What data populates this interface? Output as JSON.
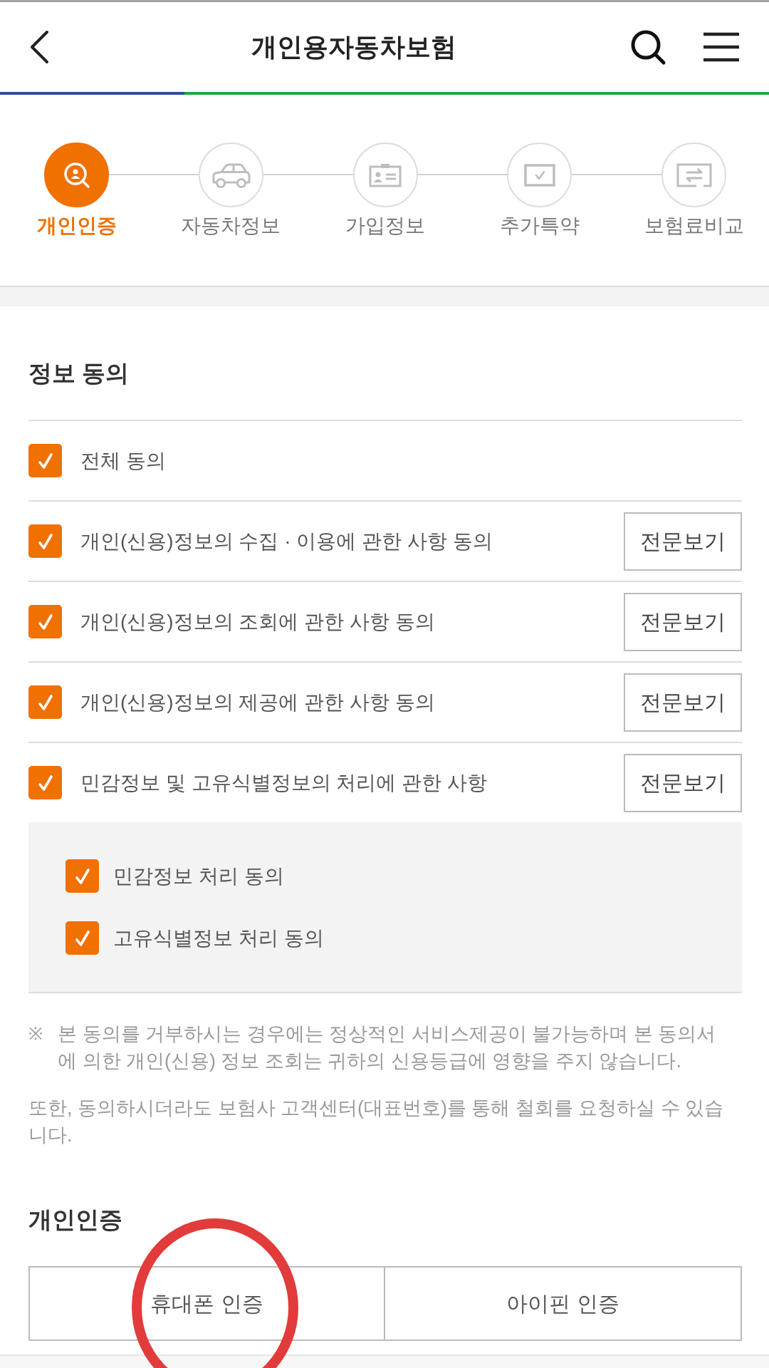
{
  "header": {
    "title": "개인용자동차보험"
  },
  "progress": {
    "level": 0.24
  },
  "steps": [
    {
      "label": "개인인증",
      "selected": true
    },
    {
      "label": "자동차정보",
      "selected": false
    },
    {
      "label": "가입정보",
      "selected": false
    },
    {
      "label": "추가특약",
      "selected": false
    },
    {
      "label": "보험료비교",
      "selected": false
    }
  ],
  "consent": {
    "title": "정보 동의",
    "items": [
      {
        "label": "전체 동의",
        "checked": true
      },
      {
        "label": "개인(신용)정보의 수집 · 이용에 관한 사항 동의",
        "checked": true,
        "button": "전문보기"
      },
      {
        "label": "개인(신용)정보의 조회에 관한 사항 동의",
        "checked": true,
        "button": "전문보기"
      },
      {
        "label": "개인(신용)정보의 제공에 관한 사항 동의",
        "checked": true,
        "button": "전문보기"
      },
      {
        "label": "민감정보 및 고유식별정보의 처리에 관한 사항",
        "checked": true,
        "button": "전문보기",
        "children": [
          {
            "label": "민감정보 처리 동의",
            "checked": true
          },
          {
            "label": "고유식별정보 처리 동의",
            "checked": true
          }
        ]
      }
    ]
  },
  "notes": [
    {
      "kind": "marked",
      "mark": "※",
      "text": "본 동의를 거부하시는 경우에는 정상적인 서비스제공이 불가능하며 본 동의서에 의한 개인(신용) 정보 조회는 귀하의 신용등급에 영향을 주지 않습니다."
    },
    {
      "kind": "plain",
      "text": "또한, 동의하시더라도 보험사 고객센터(대표번호)를 통해 철회를 요청하실 수 있습니다."
    }
  ],
  "auth": {
    "title": "개인인증",
    "methods": [
      {
        "label": "휴대폰 인증",
        "circled": true
      },
      {
        "label": "아이핀 인증",
        "circled": false
      }
    ]
  }
}
